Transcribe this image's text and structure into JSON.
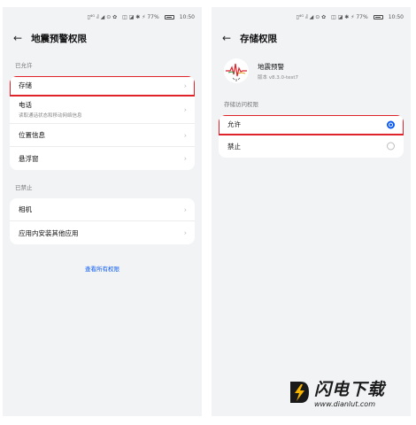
{
  "left": {
    "status": {
      "icons": "▯⁴ᴳ ᵢl ◢ ⊙ ✿",
      "right_icons": "◫ ◪ ✱ ⚡ 77%",
      "time": "10:50"
    },
    "title": "地震预警权限",
    "allowed_header": "已允许",
    "allowed_items": [
      {
        "label": "存储",
        "sub": ""
      },
      {
        "label": "电话",
        "sub": "读取通话状态和移动网络信息"
      },
      {
        "label": "位置信息",
        "sub": ""
      },
      {
        "label": "悬浮窗",
        "sub": ""
      }
    ],
    "denied_header": "已禁止",
    "denied_items": [
      {
        "label": "相机"
      },
      {
        "label": "应用内安装其他应用"
      }
    ],
    "view_all_link": "查看所有权限"
  },
  "right": {
    "status": {
      "icons": "▯⁴ᴳ ᵢl ◢ ⊙ ✿",
      "right_icons": "◫ ◪ ✱ ⚡ 77%",
      "time": "10:50"
    },
    "title": "存储权限",
    "app_name": "地震预警",
    "app_version": "版本 v8.3.0-test7",
    "access_header": "存储访问权限",
    "options": [
      {
        "label": "允许",
        "selected": true
      },
      {
        "label": "禁止",
        "selected": false
      }
    ]
  },
  "watermark": {
    "name": "闪电下载",
    "url": "www.dianlut.com"
  },
  "colors": {
    "accent": "#0a59f7",
    "highlight": "#e0222a",
    "background": "#f1f3f5"
  }
}
